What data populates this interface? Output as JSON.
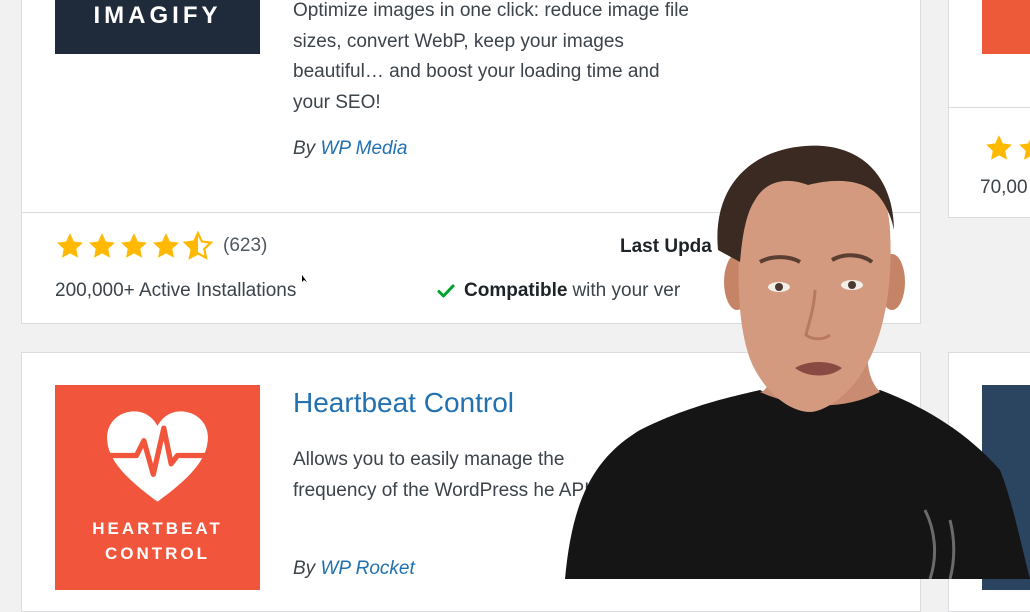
{
  "plugins": [
    {
      "logo_text": "IMAGIFY",
      "description": "Optimize images in one click: reduce image file sizes, convert WebP, keep your images beautiful… and boost your loading time and your SEO!",
      "author_prefix": "By",
      "author": "WP Media",
      "rating": 4.5,
      "rating_count": "(623)",
      "active_installs": "200,000+ Active Installations",
      "last_updated_label": "Last Upda",
      "compatible_bold": "Compatible",
      "compatible_rest": "with your ver"
    },
    {
      "title": "Heartbeat Control",
      "logo_line1": "HEARTBEAT",
      "logo_line2": "CONTROL",
      "description": "Allows you to easily manage the frequency of the WordPress he API.",
      "author_prefix": "By",
      "author": "WP Rocket"
    }
  ],
  "right_column": {
    "active_installs_partial": "70,00"
  },
  "colors": {
    "link": "#2271b1",
    "star": "#ffb900",
    "compatible_check": "#00a32a",
    "imagify_bg": "#1f2a3a",
    "heartbeat_bg": "#f1563c"
  },
  "icons": [
    "star-icon",
    "half-star-icon",
    "check-icon",
    "heart-pulse-icon"
  ]
}
